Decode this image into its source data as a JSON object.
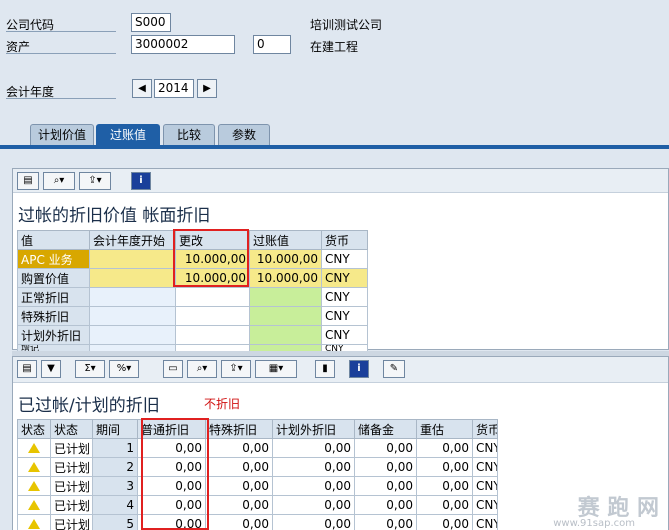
{
  "header": {
    "company_code_label": "公司代码",
    "company_code_value": "S000",
    "company_name": "培训测试公司",
    "asset_label": "资产",
    "asset_value": "3000002",
    "asset_sub_value": "0",
    "asset_desc": "在建工程",
    "fiscal_year_label": "会计年度",
    "fiscal_year_value": "2014",
    "prev_icon": "arrow-left-icon",
    "next_icon": "arrow-right-icon"
  },
  "tabs": [
    {
      "label": "计划价值",
      "active": false
    },
    {
      "label": "过账值",
      "active": true
    },
    {
      "label": "比较",
      "active": false
    },
    {
      "label": "参数",
      "active": false
    }
  ],
  "upper": {
    "title": "过帐的折旧价值 帐面折旧",
    "columns": [
      "值",
      "会计年度开始",
      "更改",
      "过账值",
      "货币"
    ],
    "rows": [
      {
        "label": "APC 业务",
        "start": "",
        "change": "10.000,00",
        "posted": "10.000,00",
        "currency": "CNY"
      },
      {
        "label": "购置价值",
        "start": "",
        "change": "10.000,00",
        "posted": "10.000,00",
        "currency": "CNY"
      },
      {
        "label": "正常折旧",
        "start": "",
        "change": "",
        "posted": "",
        "currency": "CNY"
      },
      {
        "label": "特殊折旧",
        "start": "",
        "change": "",
        "posted": "",
        "currency": "CNY"
      },
      {
        "label": "计划外折旧",
        "start": "",
        "change": "",
        "posted": "",
        "currency": "CNY"
      },
      {
        "label": "增记",
        "start": "",
        "change": "",
        "posted": "",
        "currency": "CNY"
      }
    ],
    "colors": {
      "yellow": "#f6e98a",
      "green": "#c8ee9a",
      "highlight": "#e02020"
    }
  },
  "lower": {
    "title": "已过帐/计划的折旧",
    "note": "不折旧",
    "columns": [
      "状态",
      "状态",
      "期间",
      "普通折旧",
      "特殊折旧",
      "计划外折旧",
      "储备金",
      "重估",
      "货币"
    ],
    "rows": [
      {
        "status_icon": "warning-icon",
        "status": "已计划",
        "period": "1",
        "normal": "0,00",
        "special": "0,00",
        "unplanned": "0,00",
        "reserve": "0,00",
        "reval": "0,00",
        "currency": "CNY"
      },
      {
        "status_icon": "warning-icon",
        "status": "已计划",
        "period": "2",
        "normal": "0,00",
        "special": "0,00",
        "unplanned": "0,00",
        "reserve": "0,00",
        "reval": "0,00",
        "currency": "CNY"
      },
      {
        "status_icon": "warning-icon",
        "status": "已计划",
        "period": "3",
        "normal": "0,00",
        "special": "0,00",
        "unplanned": "0,00",
        "reserve": "0,00",
        "reval": "0,00",
        "currency": "CNY"
      },
      {
        "status_icon": "warning-icon",
        "status": "已计划",
        "period": "4",
        "normal": "0,00",
        "special": "0,00",
        "unplanned": "0,00",
        "reserve": "0,00",
        "reval": "0,00",
        "currency": "CNY"
      },
      {
        "status_icon": "warning-icon",
        "status": "已计划",
        "period": "5",
        "normal": "0,00",
        "special": "0,00",
        "unplanned": "0,00",
        "reserve": "0,00",
        "reval": "0,00",
        "currency": "CNY"
      }
    ]
  },
  "watermark": {
    "text": "赛 跑 网",
    "url": "www.91sap.com"
  },
  "toolbar_upper": [
    "print-icon",
    "find-icon",
    "export-icon",
    "info-icon"
  ],
  "toolbar_lower": [
    "print-icon",
    "filter-icon",
    "sum-icon",
    "subtotal-icon",
    "print-preview-icon",
    "find-icon",
    "export-icon",
    "layout-icon",
    "chart-icon",
    "info-icon",
    "notes-icon"
  ]
}
